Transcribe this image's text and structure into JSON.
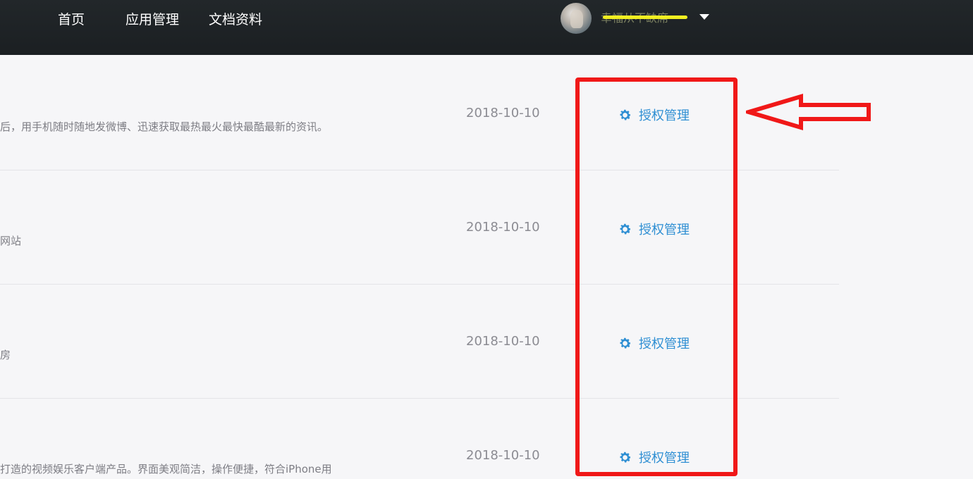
{
  "nav": {
    "items": [
      "首页",
      "应用管理",
      "文档资料"
    ],
    "username": "幸福从不缺席"
  },
  "rows": [
    {
      "description": "后，用手机随时随地发微博、迅速获取最热最火最快最酷最新的资讯。",
      "date": "2018-10-10",
      "action": "授权管理"
    },
    {
      "description": "网站",
      "date": "2018-10-10",
      "action": "授权管理"
    },
    {
      "description": "房",
      "date": "2018-10-10",
      "action": "授权管理"
    },
    {
      "description": "打造的视频娱乐客户端产品。界面美观简洁，操作便捷，符合iPhone用",
      "date": "2018-10-10",
      "action": "授权管理"
    }
  ],
  "colors": {
    "topbar": "#1e2326",
    "link": "#2f8fd3",
    "annotation": "#f01818",
    "highlight": "#f2ef21"
  },
  "icons": {
    "action": "gear-icon",
    "user_menu": "chevron-down-icon"
  }
}
